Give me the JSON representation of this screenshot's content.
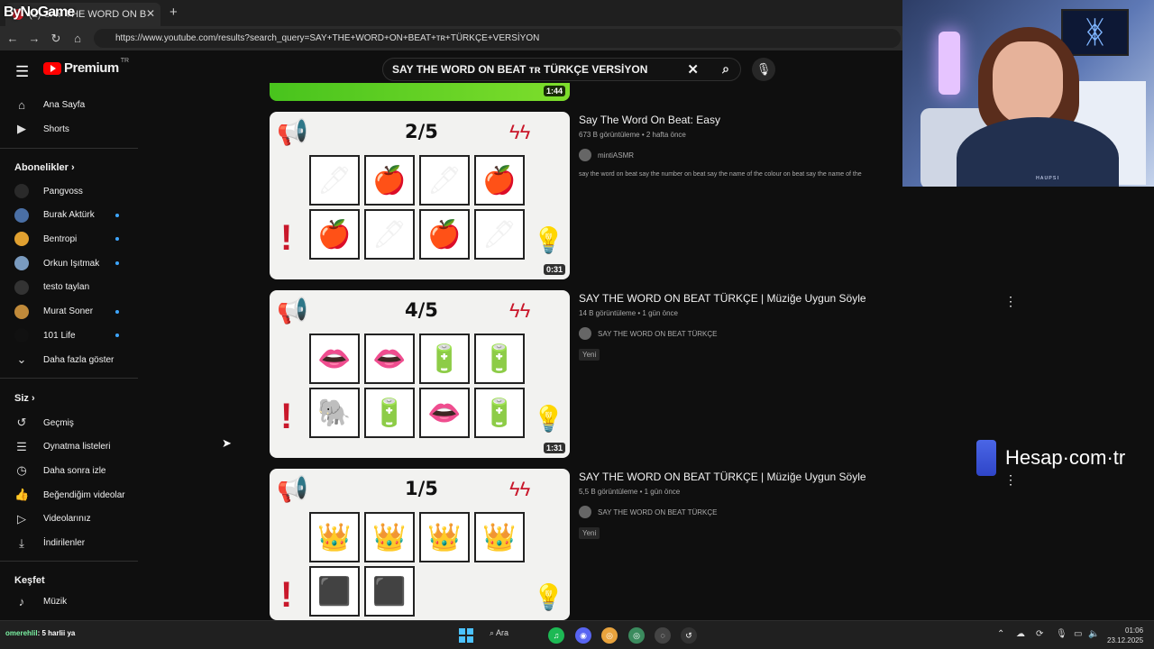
{
  "browser": {
    "tab_title": "(2) SAY THE WORD ON BEAT...",
    "watermark": "ByNoGame",
    "url": "https://www.youtube.com/results?search_query=SAY+THE+WORD+ON+BEAT+ᴛʀ+TÜRKÇE+VERSİYON",
    "new_tab": "+"
  },
  "youtube": {
    "logo_text": "Premium",
    "logo_region": "TR",
    "search_query": "SAY THE WORD ON BEAT ᴛʀ TÜRKÇE VERSİYON"
  },
  "sidebar": {
    "main": [
      {
        "label": "Ana Sayfa",
        "icon": "home-icon"
      },
      {
        "label": "Shorts",
        "icon": "shorts-icon"
      }
    ],
    "subs_heading": "Abonelikler",
    "subscriptions": [
      {
        "label": "Pangvoss",
        "color": "#2a2a2a",
        "dot": false
      },
      {
        "label": "Burak Aktürk",
        "color": "#4a6fa5",
        "dot": true
      },
      {
        "label": "Bentropi",
        "color": "#e0a030",
        "dot": true
      },
      {
        "label": "Orkun Işıtmak",
        "color": "#7a9bbf",
        "dot": true
      },
      {
        "label": "testo taylan",
        "color": "#333333",
        "dot": false
      },
      {
        "label": "Murat Soner",
        "color": "#c08a3a",
        "dot": true
      },
      {
        "label": "101 Life",
        "color": "#111111",
        "dot": true
      }
    ],
    "show_more": "Daha fazla göster",
    "you_heading": "Siz",
    "you_items": [
      {
        "label": "Geçmiş",
        "icon": "history-icon"
      },
      {
        "label": "Oynatma listeleri",
        "icon": "playlists-icon"
      },
      {
        "label": "Daha sonra izle",
        "icon": "watch-later-icon"
      },
      {
        "label": "Beğendiğim videolar",
        "icon": "liked-icon"
      },
      {
        "label": "Videolarınız",
        "icon": "your-videos-icon"
      },
      {
        "label": "İndirilenler",
        "icon": "downloads-icon"
      }
    ],
    "explore_heading": "Keşfet",
    "explore_items": [
      {
        "label": "Müzik",
        "icon": "music-icon"
      }
    ]
  },
  "results": {
    "partial_duration": "1:44",
    "videos": [
      {
        "title": "Say The Word On Beat: Easy",
        "meta": "673 B görüntüleme • 2 hafta önce",
        "channel": "mintiASMR",
        "description": "say the word on beat say the number on beat say the name of the colour on beat say the name of the",
        "thumb_count": "2/5",
        "duration": "0:31",
        "badge": ""
      },
      {
        "title": "SAY THE WORD ON BEAT TÜRKÇE | Müziğe Uygun Söyle",
        "meta": "14 B görüntüleme • 1 gün önce",
        "channel": "SAY THE WORD ON BEAT TÜRKÇE",
        "thumb_count": "4/5",
        "duration": "1:31",
        "badge": "Yeni"
      },
      {
        "title": "SAY THE WORD ON BEAT TÜRKÇE | Müziğe Uygun Söyle",
        "meta": "5,5 B görüntüleme • 1 gün önce",
        "channel": "SAY THE WORD ON BEAT TÜRKÇE",
        "thumb_count": "1/5",
        "duration": "",
        "badge": "Yeni"
      }
    ]
  },
  "overlay": {
    "sponsor": "Hesap·com·tr",
    "cam_shirt_text": "ʜᴀᴜᴘsı"
  },
  "taskbar": {
    "chat_user": "omerehlil",
    "chat_msg": ": 5 harlii ya",
    "search_label": "Ara",
    "time": "01:06",
    "date": "23.12.2025"
  }
}
